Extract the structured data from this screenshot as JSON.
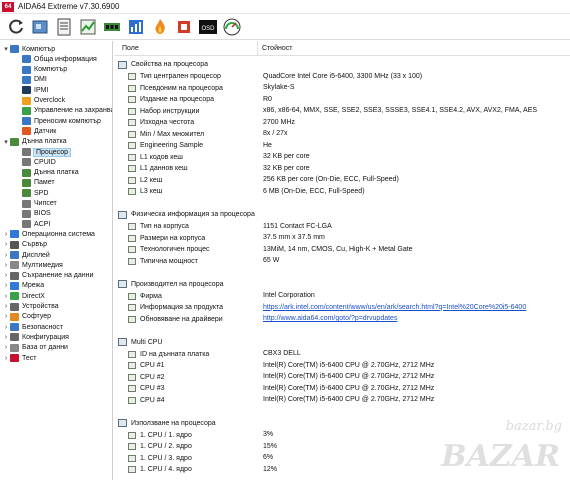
{
  "app": {
    "icon_text": "64",
    "title": "AIDA64 Extreme v7.30.6900"
  },
  "toolbar": {
    "buttons": [
      "refresh-icon",
      "motherboard-icon",
      "document-icon",
      "chart-icon",
      "memory-icon",
      "benchmark-icon",
      "flame-icon",
      "cpu-icon",
      "osd-icon",
      "gauge-icon"
    ],
    "osd_label": "OSD"
  },
  "tree": [
    {
      "label": "Компютър",
      "level": 0,
      "arrow": "▾",
      "icon": "computer-icon",
      "color": "#3b78c4"
    },
    {
      "label": "Обща информация",
      "level": 1,
      "arrow": "",
      "icon": "summary-icon",
      "color": "#3b78c4"
    },
    {
      "label": "Компютър",
      "level": 1,
      "arrow": "",
      "icon": "computer-name-icon",
      "color": "#3b78c4"
    },
    {
      "label": "DMI",
      "level": 1,
      "arrow": "",
      "icon": "dmi-icon",
      "color": "#3b78c4"
    },
    {
      "label": "IPMI",
      "level": 1,
      "arrow": "",
      "icon": "ipmi-icon",
      "color": "#1f3b5c"
    },
    {
      "label": "Overclock",
      "level": 1,
      "arrow": "",
      "icon": "overclock-icon",
      "color": "#f0a020"
    },
    {
      "label": "Управление на захранването",
      "level": 1,
      "arrow": "",
      "icon": "power-icon",
      "color": "#3aa04a"
    },
    {
      "label": "Преносим компютър",
      "level": 1,
      "arrow": "",
      "icon": "laptop-icon",
      "color": "#3b78c4"
    },
    {
      "label": "Датчик",
      "level": 1,
      "arrow": "",
      "icon": "sensor-icon",
      "color": "#e05a20"
    },
    {
      "label": "Дънна платка",
      "level": 0,
      "arrow": "▾",
      "icon": "motherboard-icon",
      "color": "#4a8a3a"
    },
    {
      "label": "Процесор",
      "level": 1,
      "arrow": "",
      "icon": "cpu-icon",
      "color": "#777777",
      "selected": true
    },
    {
      "label": "CPUID",
      "level": 1,
      "arrow": "",
      "icon": "cpuid-icon",
      "color": "#777777"
    },
    {
      "label": "Дънна платка",
      "level": 1,
      "arrow": "",
      "icon": "board-icon",
      "color": "#4a8a3a"
    },
    {
      "label": "Памет",
      "level": 1,
      "arrow": "",
      "icon": "memory-icon",
      "color": "#4a8a3a"
    },
    {
      "label": "SPD",
      "level": 1,
      "arrow": "",
      "icon": "spd-icon",
      "color": "#4a8a3a"
    },
    {
      "label": "Чипсет",
      "level": 1,
      "arrow": "",
      "icon": "chipset-icon",
      "color": "#777777"
    },
    {
      "label": "BIOS",
      "level": 1,
      "arrow": "",
      "icon": "bios-icon",
      "color": "#777777"
    },
    {
      "label": "ACPI",
      "level": 1,
      "arrow": "",
      "icon": "acpi-icon",
      "color": "#777777"
    },
    {
      "label": "Операционна система",
      "level": 0,
      "arrow": "›",
      "icon": "windows-icon",
      "color": "#2f7ad6"
    },
    {
      "label": "Сървър",
      "level": 0,
      "arrow": "›",
      "icon": "server-icon",
      "color": "#555555"
    },
    {
      "label": "Дисплей",
      "level": 0,
      "arrow": "›",
      "icon": "display-icon",
      "color": "#3b78c4"
    },
    {
      "label": "Мултимедия",
      "level": 0,
      "arrow": "›",
      "icon": "multimedia-icon",
      "color": "#888888"
    },
    {
      "label": "Съхранение на данни",
      "level": 0,
      "arrow": "›",
      "icon": "storage-icon",
      "color": "#666666"
    },
    {
      "label": "Мрежа",
      "level": 0,
      "arrow": "›",
      "icon": "network-icon",
      "color": "#2f7ad6"
    },
    {
      "label": "DirectX",
      "level": 0,
      "arrow": "›",
      "icon": "directx-icon",
      "color": "#3aa04a"
    },
    {
      "label": "Устройства",
      "level": 0,
      "arrow": "›",
      "icon": "devices-icon",
      "color": "#666666"
    },
    {
      "label": "Софтуер",
      "level": 0,
      "arrow": "›",
      "icon": "software-icon",
      "color": "#e08a20"
    },
    {
      "label": "Безопасност",
      "level": 0,
      "arrow": "›",
      "icon": "security-icon",
      "color": "#3b78c4"
    },
    {
      "label": "Конфигурация",
      "level": 0,
      "arrow": "›",
      "icon": "config-icon",
      "color": "#666666"
    },
    {
      "label": "База от данни",
      "level": 0,
      "arrow": "›",
      "icon": "database-icon",
      "color": "#888888"
    },
    {
      "label": "Тест",
      "level": 0,
      "arrow": "›",
      "icon": "test-icon",
      "color": "#c8102e"
    }
  ],
  "columns": {
    "field": "Поле",
    "value": "Стойност"
  },
  "sections": [
    {
      "title": "Свойства на процесора",
      "rows": [
        {
          "field": "Тип централен процесор",
          "value": "QuadCore Intel Core i5-6400, 3300 MHz (33 x 100)"
        },
        {
          "field": "Псевдоним на процесора",
          "value": "Skylake-S"
        },
        {
          "field": "Издание на процесора",
          "value": "R0"
        },
        {
          "field": "Набор инструкции",
          "value": "x86, x86-64, MMX, SSE, SSE2, SSE3, SSSE3, SSE4.1, SSE4.2, AVX, AVX2, FMA, AES"
        },
        {
          "field": "Изходна честота",
          "value": "2700 MHz"
        },
        {
          "field": "Min / Max множител",
          "value": "8x / 27x"
        },
        {
          "field": "Engineering Sample",
          "value": "Не"
        },
        {
          "field": "L1 кодов кеш",
          "value": "32 KB per core"
        },
        {
          "field": "L1 даннов кеш",
          "value": "32 KB per core"
        },
        {
          "field": "L2 кеш",
          "value": "256 KB per core  (On-Die, ECC, Full-Speed)"
        },
        {
          "field": "L3 кеш",
          "value": "6 MB  (On-Die, ECC, Full-Speed)"
        }
      ]
    },
    {
      "title": "Физическа информация за процесора",
      "rows": [
        {
          "field": "Тип на корпуса",
          "value": "1151 Contact FC-LGA"
        },
        {
          "field": "Размери на корпуса",
          "value": "37.5 mm x 37.5 mm"
        },
        {
          "field": "Технологичен процес",
          "value": "13MiM, 14 nm, CMOS, Cu, High-K + Metal Gate"
        },
        {
          "field": "Типична мощност",
          "value": "65 W"
        }
      ]
    },
    {
      "title": "Производител на процесора",
      "rows": [
        {
          "field": "Фирма",
          "value": "Intel Corporation"
        },
        {
          "field": "Информация за продукта",
          "value": "https://ark.intel.com/content/www/us/en/ark/search.html?q=Intel%20Core%20i5-6400",
          "link": true
        },
        {
          "field": "Обновяване на драйвери",
          "value": "http://www.aida64.com/goto/?p=drvupdates",
          "link": true
        }
      ]
    },
    {
      "title": "Multi CPU",
      "rows": [
        {
          "field": "ID на дънната платка",
          "value": "CBX3 DELL"
        },
        {
          "field": "CPU #1",
          "value": "Intel(R) Core(TM) i5-6400 CPU @ 2.70GHz, 2712 MHz"
        },
        {
          "field": "CPU #2",
          "value": "Intel(R) Core(TM) i5-6400 CPU @ 2.70GHz, 2712 MHz"
        },
        {
          "field": "CPU #3",
          "value": "Intel(R) Core(TM) i5-6400 CPU @ 2.70GHz, 2712 MHz"
        },
        {
          "field": "CPU #4",
          "value": "Intel(R) Core(TM) i5-6400 CPU @ 2.70GHz, 2712 MHz"
        }
      ]
    },
    {
      "title": "Използване на процесора",
      "rows": [
        {
          "field": "1. CPU / 1. ядро",
          "value": "3%"
        },
        {
          "field": "1. CPU / 2. ядро",
          "value": "15%"
        },
        {
          "field": "1. CPU / 3. ядро",
          "value": "6%"
        },
        {
          "field": "1. CPU / 4. ядро",
          "value": "12%"
        }
      ]
    }
  ],
  "watermark": {
    "small": "bazar.bg",
    "large": "BAZAR"
  }
}
